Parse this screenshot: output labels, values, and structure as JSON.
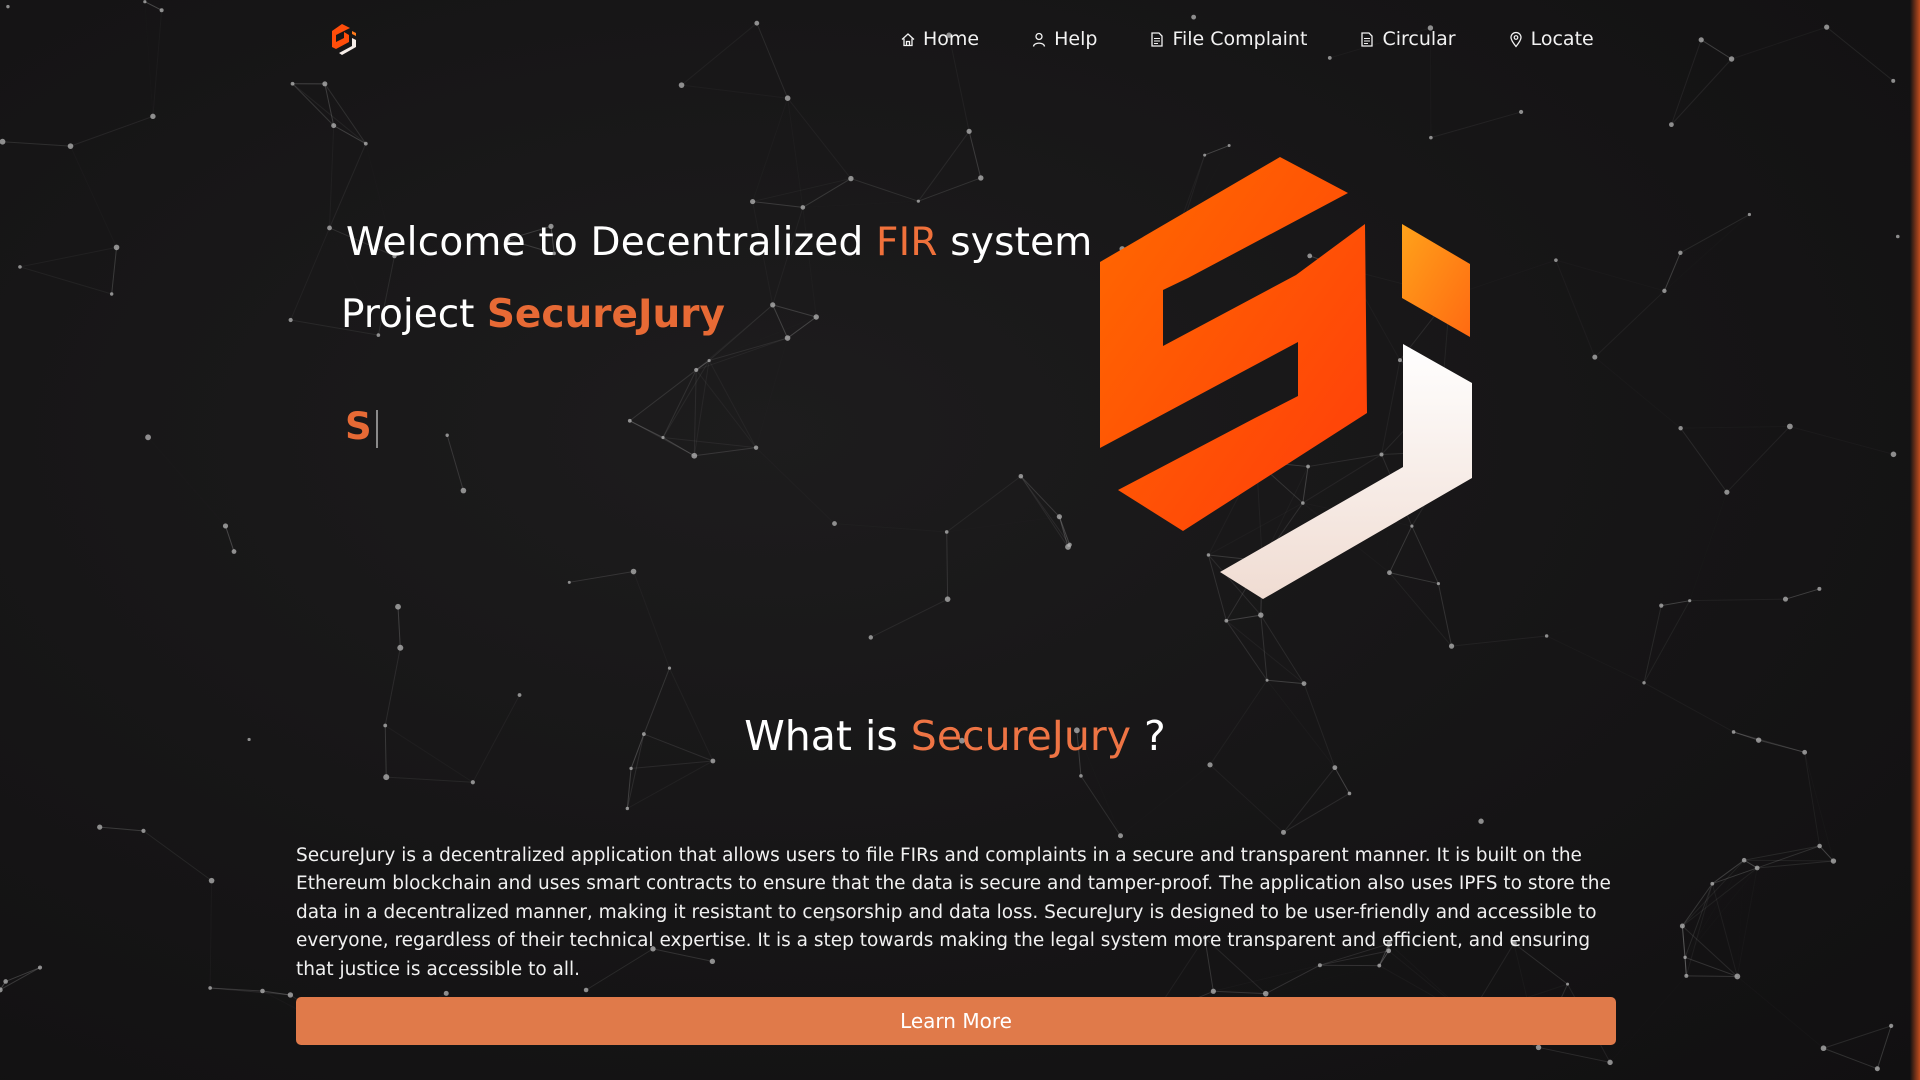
{
  "nav": {
    "logo_icon": "securejury-logo-icon",
    "items": [
      {
        "label": "Home",
        "icon": "home-icon"
      },
      {
        "label": "Help",
        "icon": "user-icon"
      },
      {
        "label": "File Complaint",
        "icon": "document-icon"
      },
      {
        "label": "Circular",
        "icon": "document-icon"
      },
      {
        "label": "Locate",
        "icon": "map-pin-icon"
      }
    ]
  },
  "hero": {
    "line1_prefix": "Welcome to Decentralized ",
    "line1_accent": "FIR",
    "line1_suffix": " system",
    "line2_prefix": "Project ",
    "line2_accent": "SecureJury",
    "typed_text": "S",
    "logo_icon": "securejury-logo-large"
  },
  "about": {
    "title_prefix": "What is ",
    "title_accent": "SecureJury",
    "title_suffix": " ?",
    "body": "SecureJury is a decentralized application that allows users to file FIRs and complaints in a secure and transparent manner. It is built on the Ethereum blockchain and uses smart contracts to ensure that the data is secure and tamper-proof. The application also uses IPFS to store the data in a decentralized manner, making it resistant to censorship and data loss. SecureJury is designed to be user-friendly and accessible to everyone, regardless of their technical expertise. It is a step towards making the legal system more transparent and efficient, and ensuring that justice is accessible to all.",
    "button_label": "Learn More"
  },
  "colors": {
    "accent": "#e76a35",
    "button": "#e07a4a",
    "background": "#161516",
    "logo_orange": "#ff4d0a",
    "logo_white": "#f6ede8"
  }
}
